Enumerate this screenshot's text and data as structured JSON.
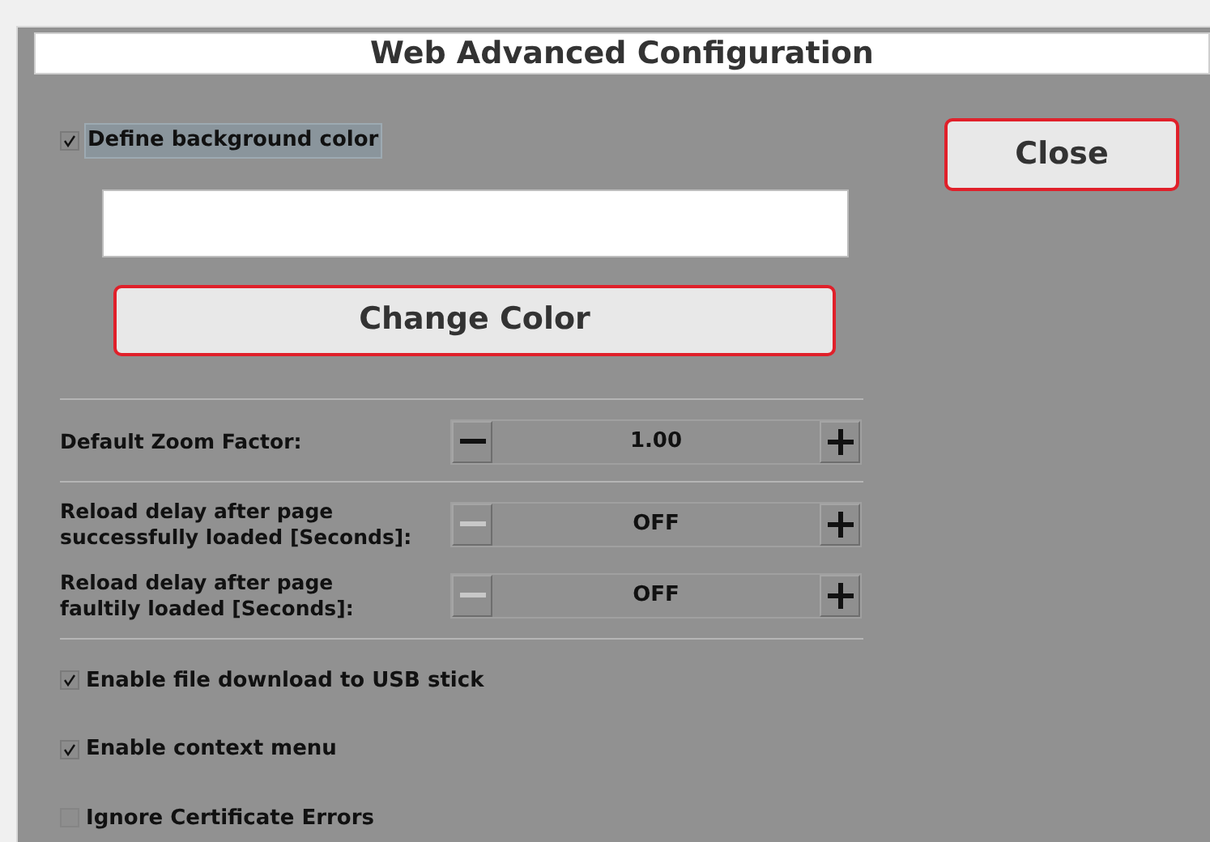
{
  "window": {
    "title": "Web Advanced Configuration"
  },
  "background_color": {
    "label": "Define background color",
    "checked": true,
    "focused": true
  },
  "change_color_button": "Change Color",
  "close_button": "Close",
  "steppers": [
    {
      "label": "Default Zoom Factor:",
      "value": "1.00",
      "minus_disabled": false,
      "plus_disabled": false
    },
    {
      "label": "Reload delay after page successfully loaded [Seconds]:",
      "value": "OFF",
      "minus_disabled": true,
      "plus_disabled": false
    },
    {
      "label": "Reload delay after page faultily loaded [Seconds]:",
      "value": "OFF",
      "minus_disabled": true,
      "plus_disabled": false
    }
  ],
  "options": [
    {
      "label": "Enable file download to USB stick",
      "checked": true
    },
    {
      "label": "Enable context menu",
      "checked": true
    },
    {
      "label": "Ignore Certificate Errors",
      "checked": false
    }
  ]
}
